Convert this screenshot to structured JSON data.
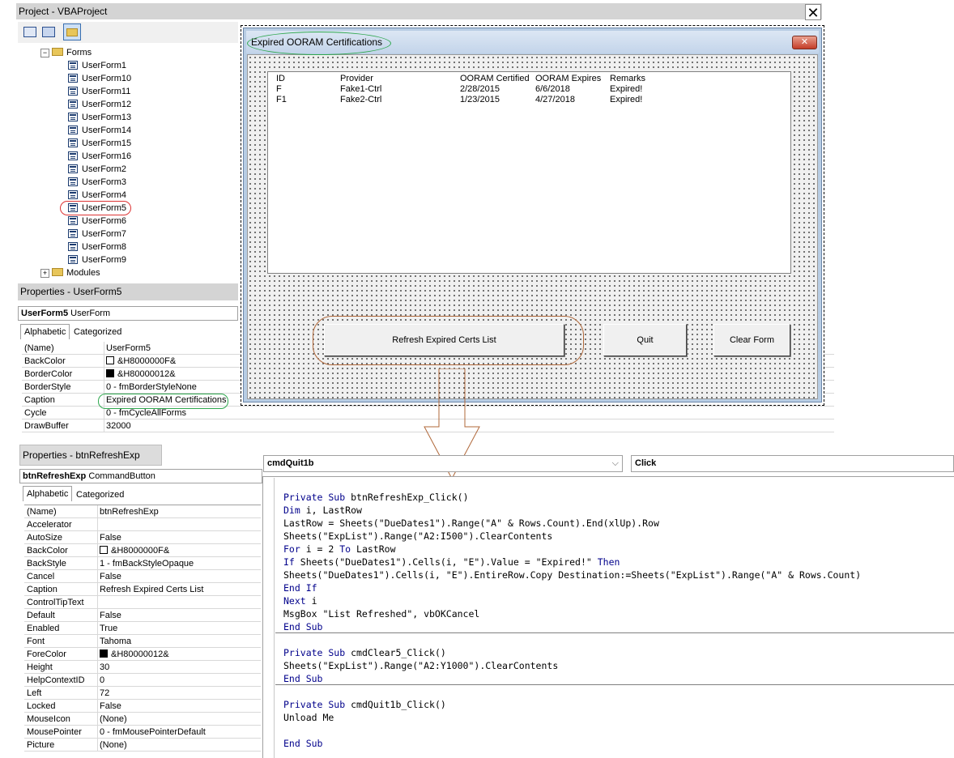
{
  "project": {
    "title": "Project - VBAProject",
    "forms_folder": "Forms",
    "modules_folder": "Modules",
    "forms": [
      "UserForm1",
      "UserForm10",
      "UserForm11",
      "UserForm12",
      "UserForm13",
      "UserForm14",
      "UserForm15",
      "UserForm16",
      "UserForm2",
      "UserForm3",
      "UserForm4",
      "UserForm5",
      "UserForm6",
      "UserForm7",
      "UserForm8",
      "UserForm9"
    ],
    "selected_form": "UserForm5"
  },
  "props_form": {
    "title": "Properties - UserForm5",
    "object_name": "UserForm5",
    "object_type": "UserForm",
    "tab_alpha": "Alphabetic",
    "tab_cat": "Categorized",
    "rows": [
      {
        "name": "(Name)",
        "value": "UserForm5"
      },
      {
        "name": "BackColor",
        "value": "&H8000000F&",
        "swatch": "#ffffff"
      },
      {
        "name": "BorderColor",
        "value": "&H80000012&",
        "swatch": "#000000"
      },
      {
        "name": "BorderStyle",
        "value": "0 - fmBorderStyleNone"
      },
      {
        "name": "Caption",
        "value": "Expired OORAM Certifications"
      },
      {
        "name": "Cycle",
        "value": "0 - fmCycleAllForms"
      },
      {
        "name": "DrawBuffer",
        "value": "32000"
      }
    ]
  },
  "userform": {
    "caption": "Expired OORAM Certifications",
    "close_glyph": "✕",
    "list_headers": [
      "ID",
      "Provider",
      "OORAM Certified",
      "OORAM Expires",
      "Remarks"
    ],
    "list_rows": [
      [
        "F",
        "Fake1-Ctrl",
        "2/28/2015",
        "6/6/2018",
        "Expired!"
      ],
      [
        "F1",
        "Fake2-Ctrl",
        "1/23/2015",
        "4/27/2018",
        "Expired!"
      ]
    ],
    "btn_refresh": "Refresh Expired Certs List",
    "btn_quit": "Quit",
    "btn_clear": "Clear Form"
  },
  "props_btn": {
    "title": "Properties - btnRefreshExp",
    "object_name": "btnRefreshExp",
    "object_type": "CommandButton",
    "tab_alpha": "Alphabetic",
    "tab_cat": "Categorized",
    "rows": [
      {
        "name": "(Name)",
        "value": "btnRefreshExp"
      },
      {
        "name": "Accelerator",
        "value": ""
      },
      {
        "name": "AutoSize",
        "value": "False"
      },
      {
        "name": "BackColor",
        "value": "&H8000000F&",
        "swatch": "#ffffff"
      },
      {
        "name": "BackStyle",
        "value": "1 - fmBackStyleOpaque"
      },
      {
        "name": "Cancel",
        "value": "False"
      },
      {
        "name": "Caption",
        "value": "Refresh Expired Certs List"
      },
      {
        "name": "ControlTipText",
        "value": ""
      },
      {
        "name": "Default",
        "value": "False"
      },
      {
        "name": "Enabled",
        "value": "True"
      },
      {
        "name": "Font",
        "value": "Tahoma"
      },
      {
        "name": "ForeColor",
        "value": "&H80000012&",
        "swatch": "#000000"
      },
      {
        "name": "Height",
        "value": "30"
      },
      {
        "name": "HelpContextID",
        "value": "0"
      },
      {
        "name": "Left",
        "value": "72"
      },
      {
        "name": "Locked",
        "value": "False"
      },
      {
        "name": "MouseIcon",
        "value": "(None)"
      },
      {
        "name": "MousePointer",
        "value": "0 - fmMousePointerDefault"
      },
      {
        "name": "Picture",
        "value": "(None)"
      }
    ]
  },
  "code": {
    "object_combo": "cmdQuit1b",
    "proc_combo": "Click",
    "lines": [
      "Private Sub btnRefreshExp_Click()",
      "Dim i, LastRow",
      "LastRow = Sheets(\"DueDates1\").Range(\"A\" & Rows.Count).End(xlUp).Row",
      "Sheets(\"ExpList\").Range(\"A2:I500\").ClearContents",
      "For i = 2 To LastRow",
      "If Sheets(\"DueDates1\").Cells(i, \"E\").Value = \"Expired!\" Then",
      "Sheets(\"DueDates1\").Cells(i, \"E\").EntireRow.Copy Destination:=Sheets(\"ExpList\").Range(\"A\" & Rows.Count)",
      "End If",
      "Next i",
      "MsgBox \"List Refreshed\", vbOKCancel",
      "End Sub",
      "Private Sub cmdClear5_Click()",
      "Sheets(\"ExpList\").Range(\"A2:Y1000\").ClearContents",
      "End Sub",
      "Private Sub cmdQuit1b_Click()",
      "Unload Me",
      "",
      "End Sub"
    ]
  },
  "close_glyph": "✕"
}
